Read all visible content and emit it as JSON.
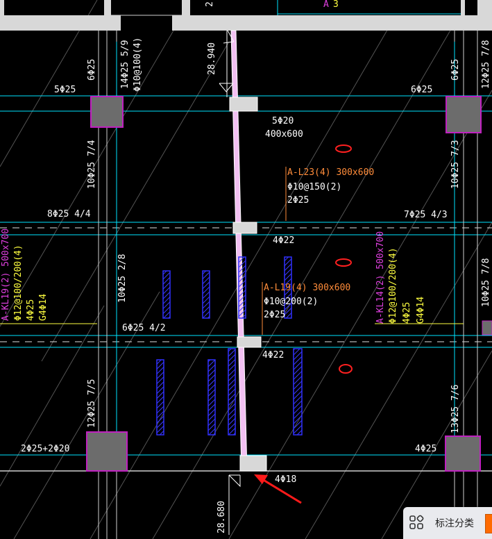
{
  "colors": {
    "background": "#000000",
    "grid_line": "#00e5ff",
    "frame_line": "#cfcfcf",
    "column_fill": "#6c6c6c",
    "column_edge": "#c020c0",
    "beam_pink": "#f2c0f2",
    "white_text": "#ffffff",
    "orange_text": "#ff8c3a",
    "magenta_text": "#e040e0",
    "yellow_text": "#ffff40",
    "blue_hatch": "#3030ff",
    "red_mark": "#ff2020",
    "arrow": "#ff1a1a"
  },
  "annotations": {
    "top_dim": "2",
    "top_right_a": "A",
    "top_right_3": "3",
    "dim_2894": "28.940",
    "dim_2868": "28.680",
    "left_col_5_9": "14Φ25 5/9",
    "left_col_stirrup": "Φ10@100(4)",
    "left_6phi25": "6Φ25",
    "left_5phi25": "5Φ25",
    "right_6phi25_v": "6Φ25",
    "right_6phi25_h": "6Φ25",
    "right_12phi25_8": "12Φ25 7/8",
    "beam_5phi20": "5Φ20",
    "beam_400x600": "400x600",
    "l23_name": "A-L23(4) 300x600",
    "l23_stirrup": "Φ10@150(2)",
    "l23_bars": "2Φ25",
    "left_10phi25_74": "10Φ25 7/4",
    "right_10phi25_73": "10Φ25 7/3",
    "left_8phi25": "8Φ25 4/4",
    "right_7phi25": "7Φ25 4/3",
    "beam_4phi22_a": "4Φ22",
    "kl19_name": "A-KL19(2) 500x700",
    "kl19_stirrup": "Φ12@100/200(4)",
    "kl19_bars": "4Φ25",
    "kl19_g": "G4Φ14",
    "left_10phi25_78": "10Φ25 2/8",
    "l19_name": "A-L19(4) 300x600",
    "l19_stirrup": "Φ10@200(2)",
    "l19_bars": "2Φ25",
    "kl14_name": "A-KL14(2) 500x700",
    "kl14_stirrup": "Φ12@100/200(4)",
    "kl14_bars": "4Φ25",
    "kl14_g": "G4Φ14",
    "right_10phi25_78": "10Φ25 7/8",
    "left_6phi25_42": "6Φ25 4/2",
    "beam_4phi22_b": "4Φ22",
    "left_12phi25_75": "12Φ25 7/5",
    "right_13phi25_76": "13Φ25 7/6",
    "left_bottom_bars": "2Φ25+2Φ20",
    "right_4phi25": "4Φ25",
    "bottom_4phi18": "4Φ18"
  },
  "toolbar": {
    "label": "标注分类",
    "icon": "grid-apps-icon"
  }
}
